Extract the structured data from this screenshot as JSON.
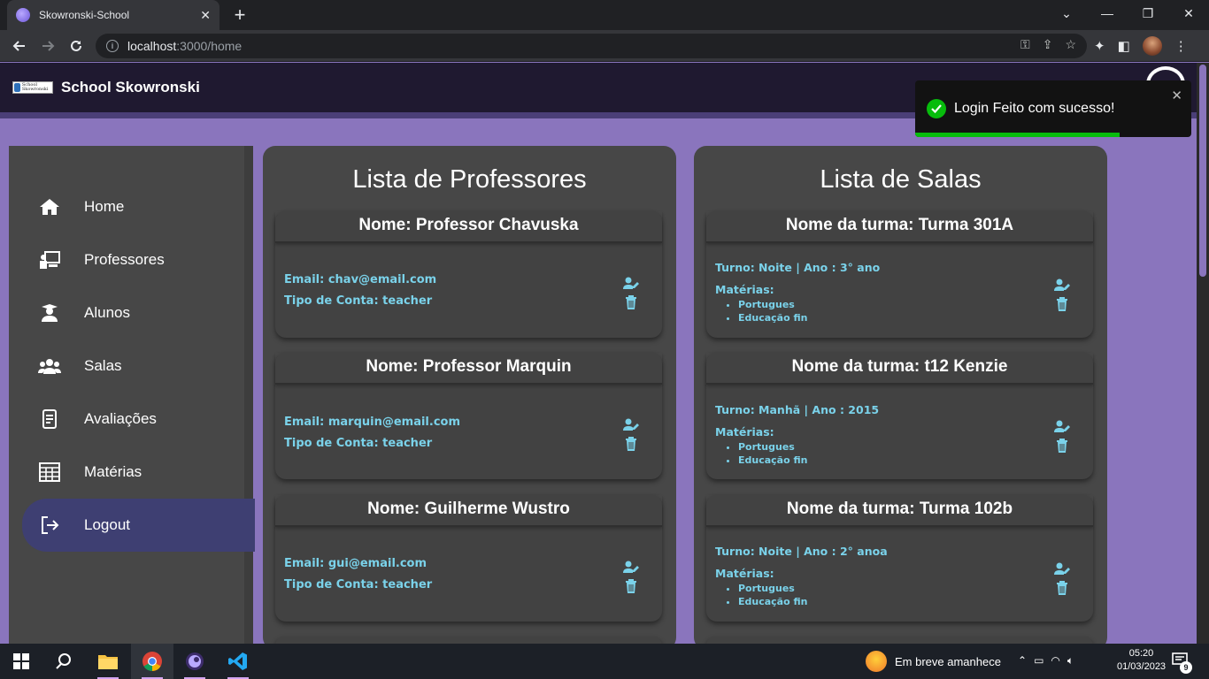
{
  "browser": {
    "tab_title": "Skowronski-School",
    "url_host": "localhost",
    "url_path": ":3000/home",
    "new_tab": "+",
    "tab_close": "✕"
  },
  "app": {
    "title": "School Skowronski",
    "logo_text": "School Skowronski"
  },
  "toast": {
    "message": "Login Feito com sucesso!",
    "close": "✕",
    "progress": 0.74,
    "color": "#07bc0c"
  },
  "sidebar": {
    "items": [
      {
        "label": "Home",
        "icon": "home-icon",
        "active": false
      },
      {
        "label": "Professores",
        "icon": "chalkboard-teacher-icon",
        "active": false
      },
      {
        "label": "Alunos",
        "icon": "user-graduate-icon",
        "active": false
      },
      {
        "label": "Salas",
        "icon": "users-icon",
        "active": false
      },
      {
        "label": "Avaliações",
        "icon": "document-icon",
        "active": false
      },
      {
        "label": "Matérias",
        "icon": "table-icon",
        "active": false
      },
      {
        "label": "Logout",
        "icon": "logout-icon",
        "active": true
      }
    ]
  },
  "teachers": {
    "title": "Lista de Professores",
    "cards": [
      {
        "name": "Nome: Professor Chavuska",
        "email": "Email: chav@email.com",
        "type": "Tipo de Conta: teacher"
      },
      {
        "name": "Nome: Professor Marquin",
        "email": "Email: marquin@email.com",
        "type": "Tipo de Conta: teacher"
      },
      {
        "name": "Nome: Guilherme Wustro",
        "email": "Email: gui@email.com",
        "type": "Tipo de Conta: teacher"
      }
    ]
  },
  "rooms": {
    "title": "Lista de Salas",
    "cards": [
      {
        "name": "Nome da turma: Turma 301A",
        "info": "Turno: Noite | Ano : 3° ano",
        "subjects_label": "Matérias:",
        "subjects": [
          "Portugues",
          "Educação fin"
        ]
      },
      {
        "name": "Nome da turma: t12 Kenzie",
        "info": "Turno: Manhã | Ano : 2015",
        "subjects_label": "Matérias:",
        "subjects": [
          "Portugues",
          "Educação fin"
        ]
      },
      {
        "name": "Nome da turma: Turma 102b",
        "info": "Turno: Noite | Ano : 2° anoa",
        "subjects_label": "Matérias:",
        "subjects": [
          "Portugues",
          "Educação fin"
        ]
      }
    ]
  },
  "colors": {
    "page_bg": "#8a75bd",
    "header_bg": "#1f1930",
    "panel_bg": "#474747",
    "accent_text": "#7ad2ea",
    "active_item": "#3e3f72"
  },
  "taskbar": {
    "weather": "Em breve amanhece",
    "time": "05:20",
    "date": "01/03/2023",
    "notifications": "9"
  }
}
